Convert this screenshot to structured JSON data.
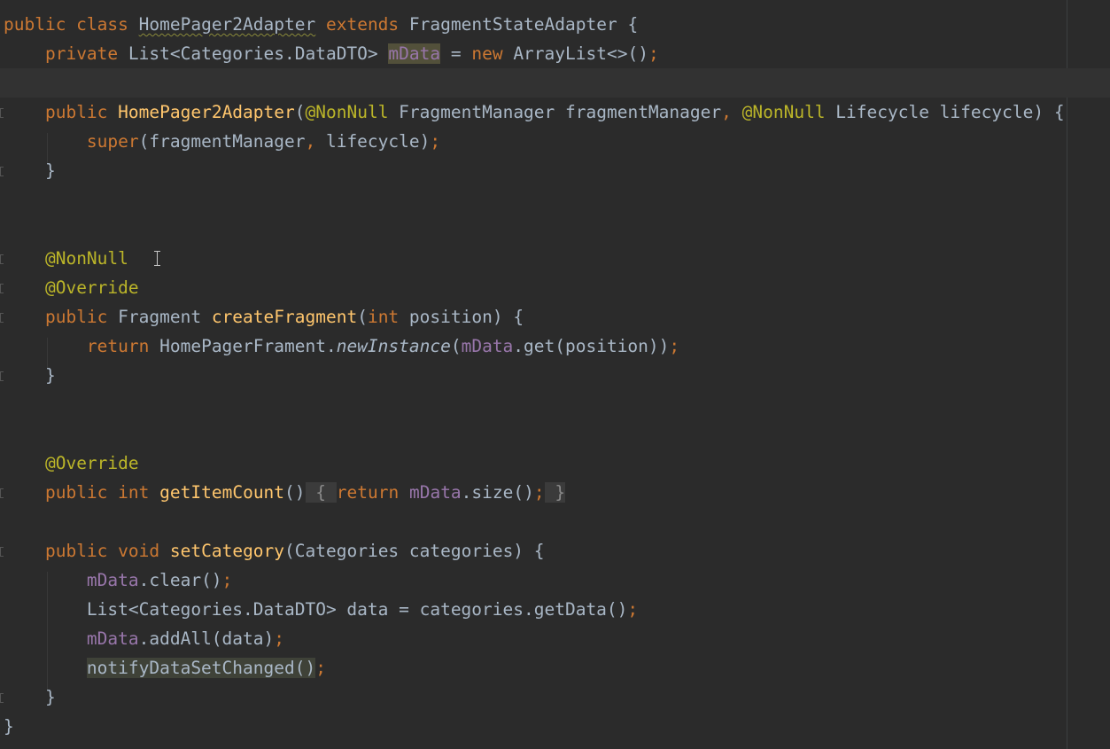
{
  "editor": {
    "language": "Java",
    "colors": {
      "background": "#2b2b2b",
      "keyword": "#cc7832",
      "annotation": "#bbb529",
      "method": "#ffc66d",
      "field": "#9876aa",
      "text": "#a9b7c6"
    },
    "lines": [
      {
        "segments": [
          "public class",
          " ",
          "HomePager2Adapter",
          " ",
          "extends",
          " FragmentStateAdapter {"
        ]
      },
      {
        "segments": [
          "    ",
          "private",
          " List<Categories.DataDTO> ",
          "mData",
          " = ",
          "new",
          " ArrayList<>()",
          ";"
        ]
      },
      {
        "segments": [
          ""
        ]
      },
      {
        "segments": [
          "    ",
          "public",
          " ",
          "HomePager2Adapter",
          "(",
          "@NonNull",
          " FragmentManager fragmentManager",
          ",",
          " ",
          "@NonNull",
          " Lifecycle lifecycle) {"
        ]
      },
      {
        "segments": [
          "        ",
          "super",
          "(fragmentManager",
          ",",
          " lifecycle)",
          ";"
        ]
      },
      {
        "segments": [
          "    }"
        ]
      },
      {
        "segments": [
          ""
        ]
      },
      {
        "segments": [
          ""
        ]
      },
      {
        "segments": [
          "    ",
          "@NonNull"
        ]
      },
      {
        "segments": [
          "    ",
          "@Override"
        ]
      },
      {
        "segments": [
          "    ",
          "public",
          " Fragment ",
          "createFragment",
          "(",
          "int",
          " position) {"
        ]
      },
      {
        "segments": [
          "        ",
          "return",
          " HomePagerFrament.",
          "newInstance",
          "(",
          "mData",
          ".get(position))",
          ";"
        ]
      },
      {
        "segments": [
          "    }"
        ]
      },
      {
        "segments": [
          ""
        ]
      },
      {
        "segments": [
          ""
        ]
      },
      {
        "segments": [
          "    ",
          "@Override"
        ]
      },
      {
        "segments": [
          "    ",
          "public",
          " ",
          "int",
          " ",
          "getItemCount",
          "()",
          " { ",
          "return",
          " ",
          "mData",
          ".size()",
          ";",
          " }"
        ]
      },
      {
        "segments": [
          ""
        ]
      },
      {
        "segments": [
          "    ",
          "public",
          " ",
          "void",
          " ",
          "setCategory",
          "(Categories categories) {"
        ]
      },
      {
        "segments": [
          "        ",
          "mData",
          ".clear()",
          ";"
        ]
      },
      {
        "segments": [
          "        List<Categories.DataDTO> data = categories.getData()",
          ";"
        ]
      },
      {
        "segments": [
          "        ",
          "mData",
          ".addAll(data)",
          ";"
        ]
      },
      {
        "segments": [
          "        ",
          "notifyDataSetChanged()",
          ";"
        ]
      },
      {
        "segments": [
          "    }"
        ]
      },
      {
        "segments": [
          "}"
        ]
      }
    ]
  }
}
